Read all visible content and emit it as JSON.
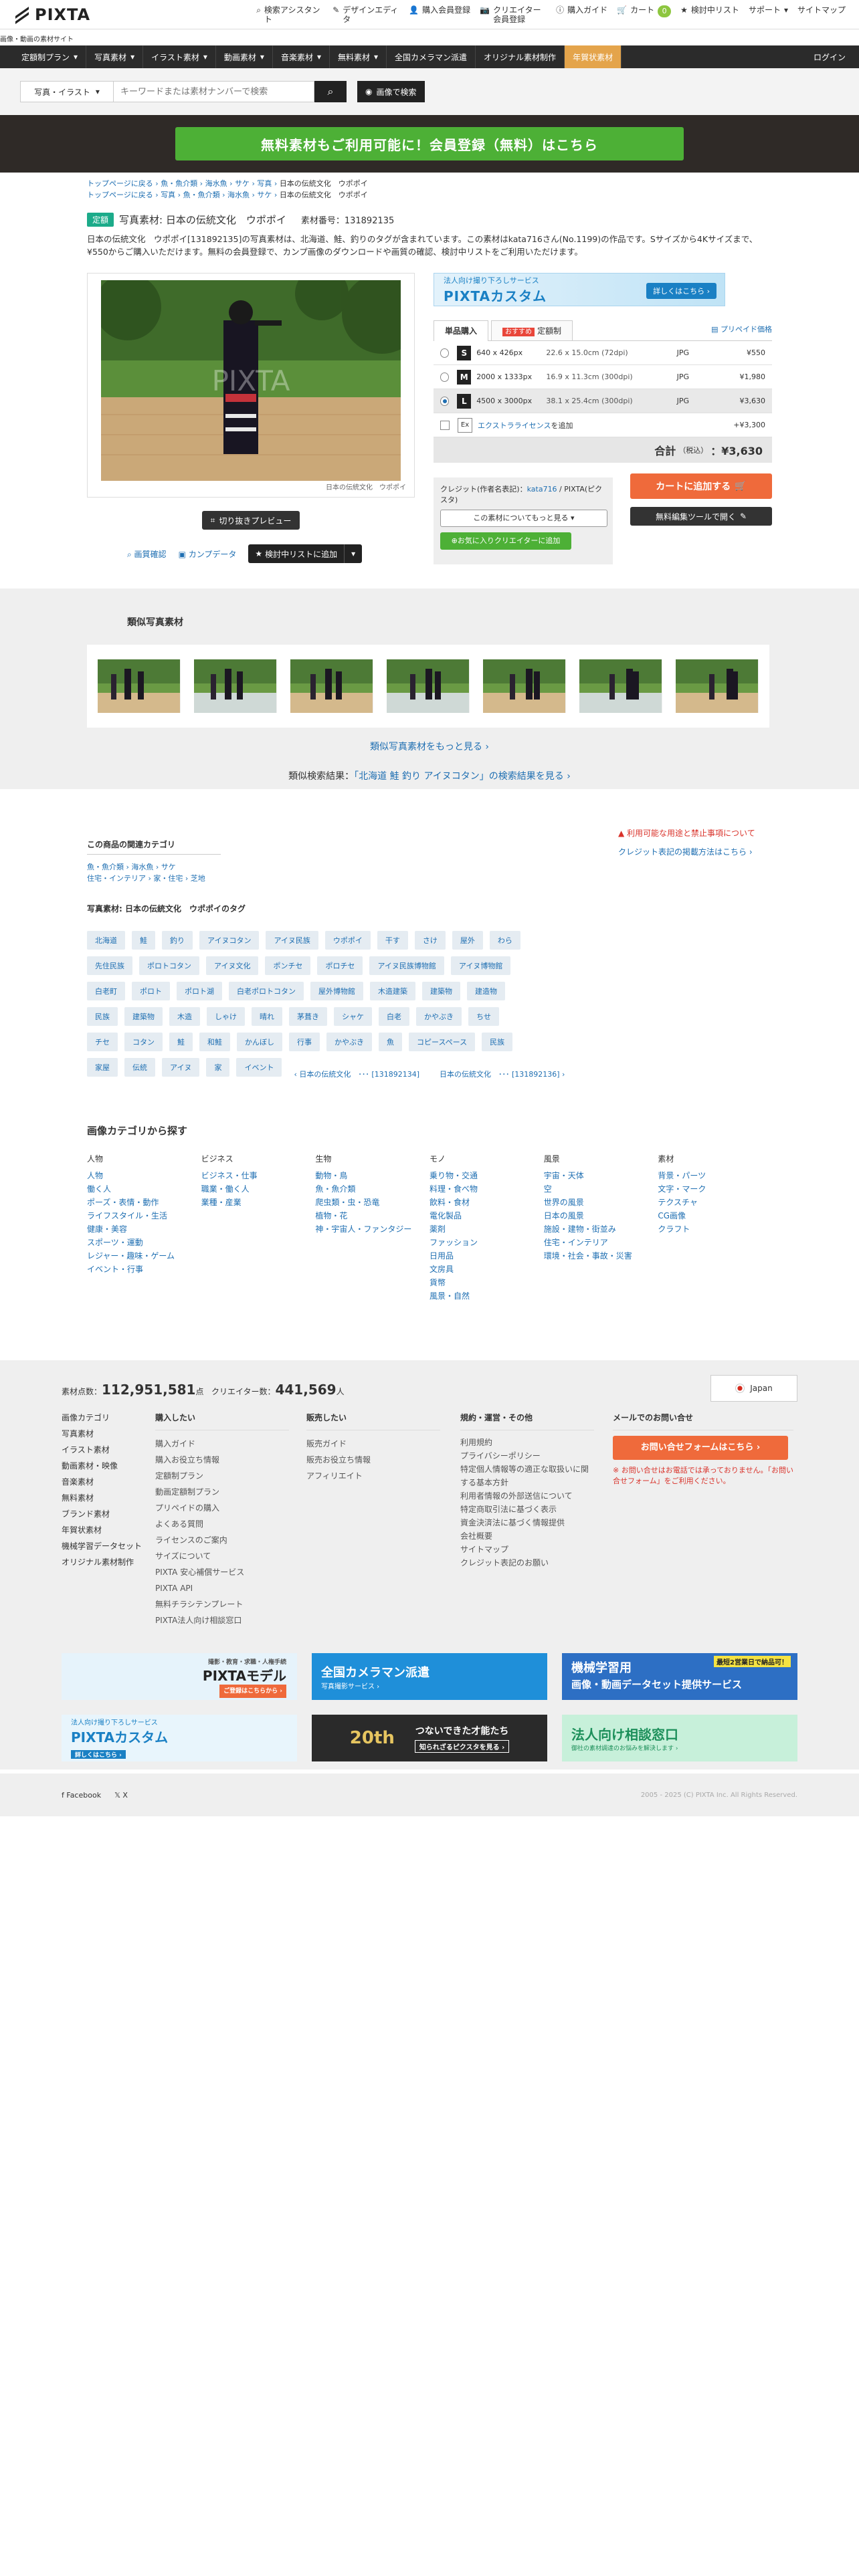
{
  "header": {
    "logo": "PIXTA",
    "tagline": "画像・動画の素材サイト",
    "nav": [
      {
        "icon": "search-icon",
        "glyph": "⌕",
        "label": "検索アシスタント"
      },
      {
        "icon": "design-editor-icon",
        "glyph": "✎",
        "label": "デザインエディタ"
      },
      {
        "icon": "user-icon",
        "glyph": "👤",
        "label": "購入会員登録"
      },
      {
        "icon": "camera-icon",
        "glyph": "📷",
        "label": "クリエイター会員登録"
      },
      {
        "icon": "info-icon",
        "glyph": "ⓘ",
        "label": "購入ガイド"
      },
      {
        "icon": "cart-icon",
        "glyph": "🛒",
        "label": "カート",
        "badge": "0"
      },
      {
        "icon": "star-icon",
        "glyph": "★",
        "label": "検討中リスト"
      },
      {
        "icon": "support-icon",
        "glyph": "",
        "label": "サポート",
        "dropdown": true
      },
      {
        "icon": "sitemap-icon",
        "glyph": "",
        "label": "サイトマップ"
      }
    ]
  },
  "catnav": {
    "items": [
      "定額制プラン",
      "写真素材",
      "イラスト素材",
      "動画素材",
      "音楽素材",
      "無料素材",
      "全国カメラマン派遣",
      "オリジナル素材制作",
      "年賀状素材"
    ],
    "login": "ログイン"
  },
  "search": {
    "type_select": "写真・イラスト",
    "placeholder": "キーワードまたは素材ナンバーで検索",
    "image_search": "画像で検索"
  },
  "promo": {
    "label": "無料素材もご利用可能に！会員登録（無料）はこちら"
  },
  "breadcrumbs": [
    [
      "トップページに戻る",
      "魚・魚介類",
      "海水魚",
      "サケ",
      "写真",
      "日本の伝統文化　ウポポイ"
    ],
    [
      "トップページに戻る",
      "写真",
      "魚・魚介類",
      "海水魚",
      "サケ",
      "日本の伝統文化　ウポポイ"
    ]
  ],
  "product": {
    "badge": "定額",
    "title": "写真素材: 日本の伝統文化　ウポポイ",
    "number_label": "素材番号：131892135",
    "description": "日本の伝統文化　ウポポイ[131892135]の写真素材は、北海道、鮭、釣りのタグが含まれています。この素材はkata716さん(No.1199)の作品です。Sサイズから4Kサイズまで、¥550からご購入いただけます。無料の会員登録で、カンプ画像のダウンロードや画質の確認、検討中リストをご利用いただけます。",
    "watermark": "PIXTA",
    "image_credit": "日本の伝統文化　ウポポイ"
  },
  "actions": {
    "crop_preview": "切り抜きプレビュー",
    "check_quality": "画質確認",
    "comp_data": "カンプデータ",
    "add_favorite": "検討中リストに追加"
  },
  "purchase": {
    "banner_small": "法人向け撮り下ろしサービス",
    "banner_big": "PIXTAカスタム",
    "banner_btn": "詳しくはこちら ›",
    "tab_single": "単品購入",
    "tab_recommend": "おすすめ",
    "tab_plan": "定額制",
    "bulk_price": "プリペイド価格",
    "sizes": [
      {
        "size": "S",
        "px": "640 x 426px",
        "cm": "22.6 x 15.0cm (72dpi)",
        "format": "JPG",
        "price": "¥550",
        "selected": false
      },
      {
        "size": "M",
        "px": "2000 x 1333px",
        "cm": "16.9 x 11.3cm (300dpi)",
        "format": "JPG",
        "price": "¥1,980",
        "selected": false
      },
      {
        "size": "L",
        "px": "4500 x 3000px",
        "cm": "38.1 x 25.4cm (300dpi)",
        "format": "JPG",
        "price": "¥3,630",
        "selected": true
      }
    ],
    "extended": {
      "badge": "Ex",
      "label": "エクストラライセンス",
      "suffix": "を追加",
      "price": "+¥3,300"
    },
    "total_label": "合計",
    "total_tax": "（税込）",
    "total_value": "：¥3,630",
    "credit_label": "クレジット(作者名表記)：",
    "credit_author": "kata716",
    "credit_suffix": " / PIXTA(ピクスタ)",
    "more_about": "この素材についてもっと見る ▾",
    "fav_creator": "お気に入りクリエイターに追加",
    "add_cart": "カートに追加する",
    "edit_tool": "無料編集ツールで開く"
  },
  "similar": {
    "title": "類似写真素材",
    "more": "類似写真素材をもっと見る ›",
    "search_prefix": "類似検索結果：",
    "search_query": "「北海道 鮭 釣り アイヌコタン」",
    "search_suffix": "の検索結果を見る ›"
  },
  "related": {
    "title": "この商品の関連カテゴリ",
    "cats": [
      "魚・魚介類 › 海水魚 › サケ",
      "住宅・インテリア › 家・住宅 › 芝地"
    ],
    "warn": "利用可能な用途と禁止事項について",
    "credit_link": "クレジット表記の掲載方法はこちら ›",
    "tags_title": "写真素材: 日本の伝統文化　ウポポイのタグ",
    "tags": [
      "北海道",
      "鮭",
      "釣り",
      "アイヌコタン",
      "アイヌ民族",
      "ウポポイ",
      "干す",
      "さけ",
      "屋外",
      "わら",
      "先住民族",
      "ポロトコタン",
      "アイヌ文化",
      "ポンチセ",
      "ポロチセ",
      "アイヌ民族博物館",
      "アイヌ博物館",
      "白老町",
      "ポロト",
      "ポロト湖",
      "白老ポロトコタン",
      "屋外博物館",
      "木造建築",
      "建築物",
      "建造物",
      "民族",
      "建築物",
      "木造",
      "しゃけ",
      "晴れ",
      "茅葺き",
      "シャケ",
      "白老",
      "かやぶき",
      "ちせ",
      "チセ",
      "コタン",
      "鮭",
      "和鮭",
      "かんぼし",
      "行事",
      "かやぶき",
      "魚",
      "コピースペース",
      "民族",
      "家屋",
      "伝統",
      "アイヌ",
      "家",
      "イベント"
    ]
  },
  "pager": {
    "prev": "‹ 日本の伝統文化　･･･ [131892134]",
    "next": "日本の伝統文化　･･･ [131892136] ›"
  },
  "image_categories": {
    "title": "画像カテゴリから探す",
    "columns": [
      {
        "head": "人物",
        "items": [
          "人物",
          "働く人",
          "ポーズ・表情・動作",
          "ライフスタイル・生活",
          "健康・美容",
          "スポーツ・運動",
          "レジャー・趣味・ゲーム",
          "イベント・行事"
        ]
      },
      {
        "head": "ビジネス",
        "items": [
          "ビジネス・仕事",
          "職業・働く人",
          "業種・産業"
        ]
      },
      {
        "head": "生物",
        "items": [
          "動物・鳥",
          "魚・魚介類",
          "爬虫類・虫・恐竜",
          "植物・花",
          "神・宇宙人・ファンタジー"
        ]
      },
      {
        "head": "モノ",
        "items": [
          "乗り物・交通",
          "料理・食べ物",
          "飲料・食材",
          "電化製品",
          "薬剤",
          "ファッション",
          "日用品",
          "文房具",
          "貨幣",
          "風景・自然"
        ]
      },
      {
        "head": "風景",
        "items": [
          "宇宙・天体",
          "空",
          "世界の風景",
          "日本の風景",
          "施設・建物・街並み",
          "住宅・インテリア",
          "環境・社会・事故・災害"
        ]
      },
      {
        "head": "素材",
        "items": [
          "背景・パーツ",
          "文字・マーク",
          "テクスチャ",
          "CG画像",
          "クラフト"
        ]
      }
    ]
  },
  "footer": {
    "stats_label1": "素材点数：",
    "stats_val1": "112,951,581",
    "stats_unit1": "点",
    "stats_label2": "クリエイター数：",
    "stats_val2": "441,569",
    "stats_unit2": "人",
    "country": "Japan",
    "left_links": [
      "画像カテゴリ",
      "写真素材",
      "イラスト素材",
      "動画素材・映像",
      "音楽素材",
      "無料素材",
      "ブランド素材",
      "年賀状素材",
      "機械学習データセット",
      "オリジナル素材制作"
    ],
    "buy_title": "購入したい",
    "buy_links": [
      "購入ガイド",
      "購入お役立ち情報",
      "定額制プラン",
      "動画定額制プラン",
      "プリペイドの購入",
      "よくある質問",
      "ライセンスのご案内",
      "サイズについて",
      "PIXTA 安心補償サービス",
      "PIXTA API",
      "無料チラシテンプレート",
      "PIXTA法人向け相談窓口"
    ],
    "sell_title": "販売したい",
    "sell_links": [
      "販売ガイド",
      "販売お役立ち情報",
      "アフィリエイト"
    ],
    "terms_title": "規約・運営・その他",
    "terms_links": [
      "利用規約",
      "プライバシーポリシー",
      "特定個人情報等の適正な取扱いに関する基本方針",
      "利用者情報の外部送信について",
      "特定商取引法に基づく表示",
      "資金決済法に基づく情報提供",
      "会社概要",
      "サイトマップ",
      "クレジット表記のお願い"
    ],
    "mail_title": "メールでのお問い合せ",
    "mail_btn": "お問い合せフォームはこちら",
    "mail_note": "※ お問い合せはお電話では承っておりません。「お問い合せフォーム」をご利用ください。",
    "banners": [
      {
        "t1": "撮影・教育・求職・人権手続",
        "t2": "PIXTAモデル",
        "t3": "ご登録はこちらから ›"
      },
      {
        "t1": "全国カメラマン派遣",
        "t2": "写真撮影サービス ›"
      },
      {
        "t1": "機械学習用",
        "t2": "画像・動画データセット提供サービス",
        "t3": "最短2営業日で納品可！"
      },
      {
        "t1": "法人向け撮り下ろしサービス",
        "t2": "PIXTAカスタム",
        "t3": "詳しくはこちら ›"
      },
      {
        "t1": "20th",
        "t2": "つないできた才能たち",
        "t3": "知られざるピクスタを見る ›"
      },
      {
        "t1": "法人向け相談窓口",
        "t2": "御社の素材調達のお悩みを解決します ›"
      }
    ],
    "social": [
      "Facebook",
      "X"
    ],
    "copyright": "2005 - 2025 (C) PIXTA Inc. All Rights Reserved."
  }
}
